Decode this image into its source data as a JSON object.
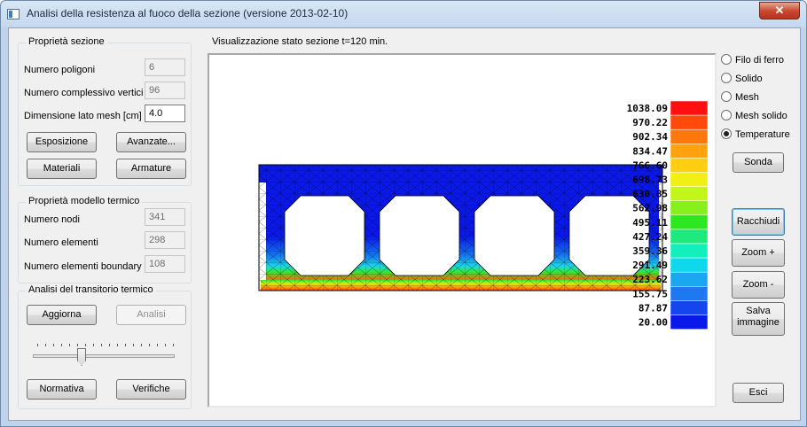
{
  "window": {
    "title": "Analisi della resistenza al fuoco della sezione (versione 2013-02-10)",
    "close_icon": "close-icon",
    "close_glyph": "✕"
  },
  "sezione": {
    "title": "Proprietà sezione",
    "poligoni_label": "Numero poligoni",
    "poligoni_value": "6",
    "vertici_label": "Numero complessivo vertici",
    "vertici_value": "96",
    "mesh_label": "Dimensione lato mesh [cm]",
    "mesh_value": "4.0",
    "esposizione": "Esposizione",
    "avanzate": "Avanzate...",
    "materiali": "Materiali",
    "armature": "Armature"
  },
  "termico": {
    "title": "Proprietà modello termico",
    "nodi_label": "Numero nodi",
    "nodi_value": "341",
    "elementi_label": "Numero elementi",
    "elementi_value": "298",
    "boundary_label": "Numero elementi boundary",
    "boundary_value": "108"
  },
  "transitorio": {
    "title": "Analisi del transitorio termico",
    "aggiorna": "Aggiorna",
    "analisi": "Analisi",
    "slider_position": 0.5,
    "normativa": "Normativa",
    "verifiche": "Verifiche"
  },
  "viz": {
    "title": "Visualizzazione stato sezione t=120 min.",
    "legend": [
      {
        "value": "1038.09",
        "color": "#ff1010"
      },
      {
        "value": "970.22",
        "color": "#ff4a0c"
      },
      {
        "value": "902.34",
        "color": "#ff780c"
      },
      {
        "value": "834.47",
        "color": "#ffa20f"
      },
      {
        "value": "766.60",
        "color": "#ffce12"
      },
      {
        "value": "698.73",
        "color": "#f0f014"
      },
      {
        "value": "630.85",
        "color": "#c2f518"
      },
      {
        "value": "562.98",
        "color": "#86f01c"
      },
      {
        "value": "495.11",
        "color": "#2de820"
      },
      {
        "value": "427.24",
        "color": "#1eea7c"
      },
      {
        "value": "359.36",
        "color": "#14eebd"
      },
      {
        "value": "291.49",
        "color": "#10d8ec"
      },
      {
        "value": "223.62",
        "color": "#1aa6f0"
      },
      {
        "value": "155.75",
        "color": "#1e78f0"
      },
      {
        "value": "87.87",
        "color": "#1446ec"
      },
      {
        "value": "20.00",
        "color": "#0a18ea"
      }
    ]
  },
  "view_options": {
    "items": [
      {
        "label": "Filo di ferro",
        "selected": false
      },
      {
        "label": "Solido",
        "selected": false
      },
      {
        "label": "Mesh",
        "selected": false
      },
      {
        "label": "Mesh solido",
        "selected": false
      },
      {
        "label": "Temperature",
        "selected": true
      }
    ],
    "sonda": "Sonda",
    "racchiudi": "Racchiudi",
    "zoom_in": "Zoom +",
    "zoom_out": "Zoom -",
    "salva_line1": "Salva",
    "salva_line2": "immagine",
    "esci": "Esci"
  }
}
